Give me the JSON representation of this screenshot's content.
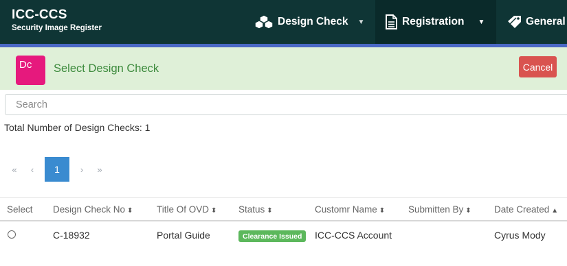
{
  "brand": {
    "title": "ICC-CCS",
    "subtitle": "Security Image Register"
  },
  "nav": [
    {
      "label": "Design Check",
      "icon": "cubes-icon"
    },
    {
      "label": "Registration",
      "icon": "document-icon"
    },
    {
      "label": "General",
      "icon": "tag-icon"
    }
  ],
  "page": {
    "badge": "Dc",
    "title": "Select Design Check",
    "cancel_label": "Cancel"
  },
  "search": {
    "placeholder": "Search",
    "value": ""
  },
  "total_text": "Total Number of Design Checks: 1",
  "pagination": {
    "first": "«",
    "prev": "‹",
    "current": "1",
    "next": "›",
    "last": "»"
  },
  "table": {
    "columns": [
      "Select",
      "Design Check No",
      "Title Of OVD",
      "Status",
      "Customr Name",
      "Submitten By",
      "Date Created"
    ],
    "rows": [
      {
        "design_check_no": "C-18932",
        "title": "Portal Guide",
        "status": "Clearance Issued",
        "customer": "ICC-CCS Account",
        "submitted_by": "",
        "date_created": "Cyrus Mody"
      }
    ]
  },
  "colors": {
    "nav_bg": "#0f3535",
    "accent": "#4a68c6",
    "header_bg": "#dff0d8",
    "badge": "#e6197d",
    "cancel": "#d9534f",
    "pager_active": "#3a8bd0",
    "status_ok": "#5cb85c"
  }
}
